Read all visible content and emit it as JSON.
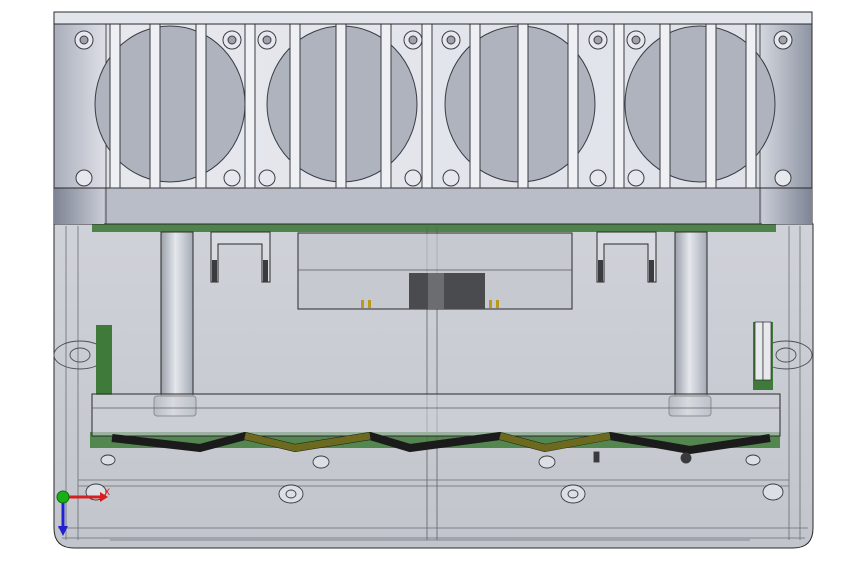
{
  "viewport": {
    "background": "#ffffff",
    "model": "enclosure-with-fan-heatsink-and-pcb",
    "view": "front-transparent"
  },
  "colors": {
    "heatsink_metal": "#d8dce4",
    "heatsink_shadow": "#9ea4b0",
    "housing_translucent": "#c9ccd2",
    "pcb_green": "#3f7a3a",
    "standoff_metal": "#bfc4cc",
    "cable_black": "#1b1b1b",
    "cable_olive": "#6b6a1e",
    "outline": "#2a2a2a"
  },
  "triad": {
    "x_color": "#d42020",
    "y_color": "#18b018",
    "z_color": "#2020d0",
    "x_label": "X",
    "icon": "axis-triad-icon"
  }
}
